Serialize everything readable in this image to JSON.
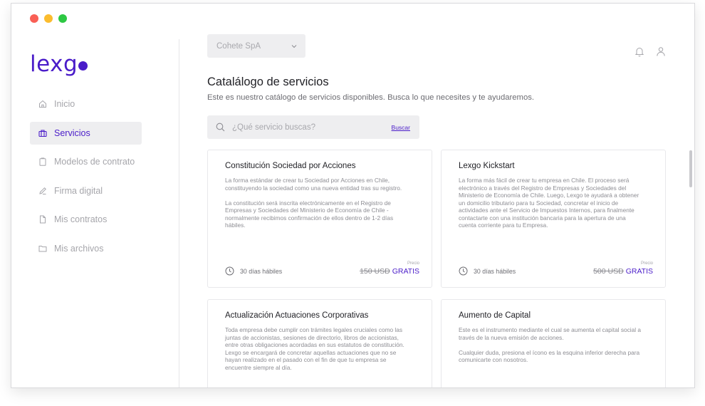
{
  "app": {
    "logo": "lexg",
    "company_selected": "Cohete SpA"
  },
  "sidebar": {
    "items": [
      {
        "label": "Inicio",
        "icon": "home-icon",
        "active": false
      },
      {
        "label": "Servicios",
        "icon": "briefcase-icon",
        "active": true
      },
      {
        "label": "Modelos de contrato",
        "icon": "clipboard-icon",
        "active": false
      },
      {
        "label": "Firma digital",
        "icon": "pen-icon",
        "active": false
      },
      {
        "label": "Mis contratos",
        "icon": "file-icon",
        "active": false
      },
      {
        "label": "Mis archivos",
        "icon": "folder-icon",
        "active": false
      }
    ]
  },
  "header": {
    "title": "Catalálogo de servicios",
    "subtitle": "Este es nuestro catálogo de servicios disponibles. Busca lo que necesites y te ayudaremos.",
    "icons": [
      "bell-icon",
      "user-icon"
    ]
  },
  "search": {
    "placeholder": "¿Qué servicio buscas?",
    "button": "Buscar"
  },
  "cards": [
    {
      "title": "Constitución Sociedad por Acciones",
      "description": "La forma estándar de crear tu Sociedad por Acciones en Chile, constituyendo la sociedad como una nueva entidad tras su registro.\n\nLa constitución será inscrita electrónicamente en el Registro de Empresas y Sociedades del Ministerio de Economía de Chile - normalmente recibimos confirmación de ellos dentro de 1-2 días hábiles.",
      "time": "30 días hábiles",
      "price_label": "Precio",
      "old_price": "150 USD",
      "price": "GRATIS"
    },
    {
      "title": "Lexgo Kickstart",
      "description": "La forma más fácil de crear tu empresa en Chile. El proceso será electrónico a través del Registro de Empresas y Sociedades del Ministerio de Economía de Chile. Luego, Lexgo te ayudará a obtener un domicilio tributario para tu Sociedad, concretar el inicio de actividades ante el Servicio de Impuestos Internos, para finalmente contactarte con una institución bancaria para la apertura de una cuenta corriente para tu Empresa.",
      "time": "30 días hábiles",
      "price_label": "Precio",
      "old_price": "500 USD",
      "price": "GRATIS"
    },
    {
      "title": "Actualización Actuaciones Corporativas",
      "description": "Toda empresa debe cumplir con trámites legales cruciales como las juntas de accionistas, sesiones de directorio, libros de accionistas, entre otras obligaciones acordadas en sus estatutos de constitución. Lexgo se encargará de concretar aquellas actuaciones que no se hayan realizado en el pasado con el fin de que tu empresa se encuentre siempre al día."
    },
    {
      "title": "Aumento de Capital",
      "description": "Este es el instrumento mediante el cual se aumenta el capital social a través de la nueva emisión de acciones.\n\nCualquier duda, presiona el ícono es la esquina inferior derecha para comunicarte con nosotros."
    }
  ],
  "colors": {
    "accent": "#4a1cc9",
    "muted": "#a6a6ab",
    "panel": "#eeeef0"
  }
}
